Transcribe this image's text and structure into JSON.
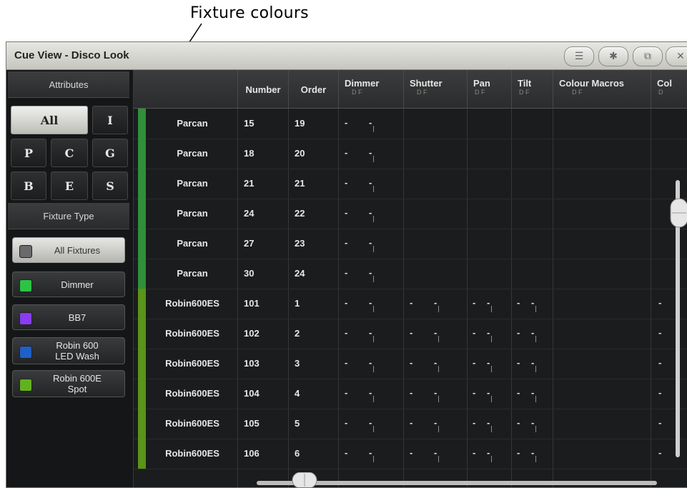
{
  "annotation": {
    "text": "Fixture colours"
  },
  "window": {
    "title": "Cue View - Disco Look"
  },
  "titlebar_buttons": [
    {
      "name": "menu-icon",
      "glyph": "☰"
    },
    {
      "name": "gear-icon",
      "glyph": "✱"
    },
    {
      "name": "resize-icon",
      "glyph": "⧉"
    },
    {
      "name": "close-icon",
      "glyph": "✕"
    }
  ],
  "left_panel": {
    "attributes_label": "Attributes",
    "attribute_buttons": [
      {
        "label": "All",
        "selected": true
      },
      {
        "label": "I"
      },
      {
        "label": "P"
      },
      {
        "label": "C"
      },
      {
        "label": "G"
      },
      {
        "label": "B"
      },
      {
        "label": "E"
      },
      {
        "label": "S"
      }
    ],
    "fixture_type_label": "Fixture Type",
    "fixture_types": [
      {
        "label": "All Fixtures",
        "color": "#6a6a6a",
        "selected": true
      },
      {
        "label": "Dimmer",
        "color": "#2cc445"
      },
      {
        "label": "BB7",
        "color": "#8a3cf0"
      },
      {
        "label": "Robin 600\nLED Wash",
        "color": "#1f5fc7"
      },
      {
        "label": "Robin 600E\nSpot",
        "color": "#62b21e"
      }
    ]
  },
  "columns": [
    {
      "key": "name",
      "label": ""
    },
    {
      "key": "number",
      "label": "Number"
    },
    {
      "key": "order",
      "label": "Order"
    },
    {
      "key": "dimmer",
      "label": "Dimmer",
      "sub": "D      F"
    },
    {
      "key": "shutter",
      "label": "Shutter",
      "sub": "D      F"
    },
    {
      "key": "pan",
      "label": "Pan",
      "sub": "D  F"
    },
    {
      "key": "tilt",
      "label": "Tilt",
      "sub": "D  F"
    },
    {
      "key": "colour_macros",
      "label": "Colour Macros",
      "sub": "D              F"
    },
    {
      "key": "col",
      "label": "Col",
      "sub": "D"
    }
  ],
  "rows": [
    {
      "name": "Parcan",
      "number": "15",
      "order": "19",
      "color": "#2f8f3a",
      "has_all": false
    },
    {
      "name": "Parcan",
      "number": "18",
      "order": "20",
      "color": "#2f8f3a",
      "has_all": false
    },
    {
      "name": "Parcan",
      "number": "21",
      "order": "21",
      "color": "#2f8f3a",
      "has_all": false
    },
    {
      "name": "Parcan",
      "number": "24",
      "order": "22",
      "color": "#2f8f3a",
      "has_all": false
    },
    {
      "name": "Parcan",
      "number": "27",
      "order": "23",
      "color": "#2f8f3a",
      "has_all": false
    },
    {
      "name": "Parcan",
      "number": "30",
      "order": "24",
      "color": "#2f8f3a",
      "has_all": false
    },
    {
      "name": "Robin600ES",
      "number": "101",
      "order": "1",
      "color": "#5a9418",
      "has_all": true
    },
    {
      "name": "Robin600ES",
      "number": "102",
      "order": "2",
      "color": "#5a9418",
      "has_all": true
    },
    {
      "name": "Robin600ES",
      "number": "103",
      "order": "3",
      "color": "#5a9418",
      "has_all": true
    },
    {
      "name": "Robin600ES",
      "number": "104",
      "order": "4",
      "color": "#5a9418",
      "has_all": true
    },
    {
      "name": "Robin600ES",
      "number": "105",
      "order": "5",
      "color": "#5a9418",
      "has_all": true
    },
    {
      "name": "Robin600ES",
      "number": "106",
      "order": "6",
      "color": "#5a9418",
      "has_all": true
    }
  ],
  "empty_value": "-"
}
